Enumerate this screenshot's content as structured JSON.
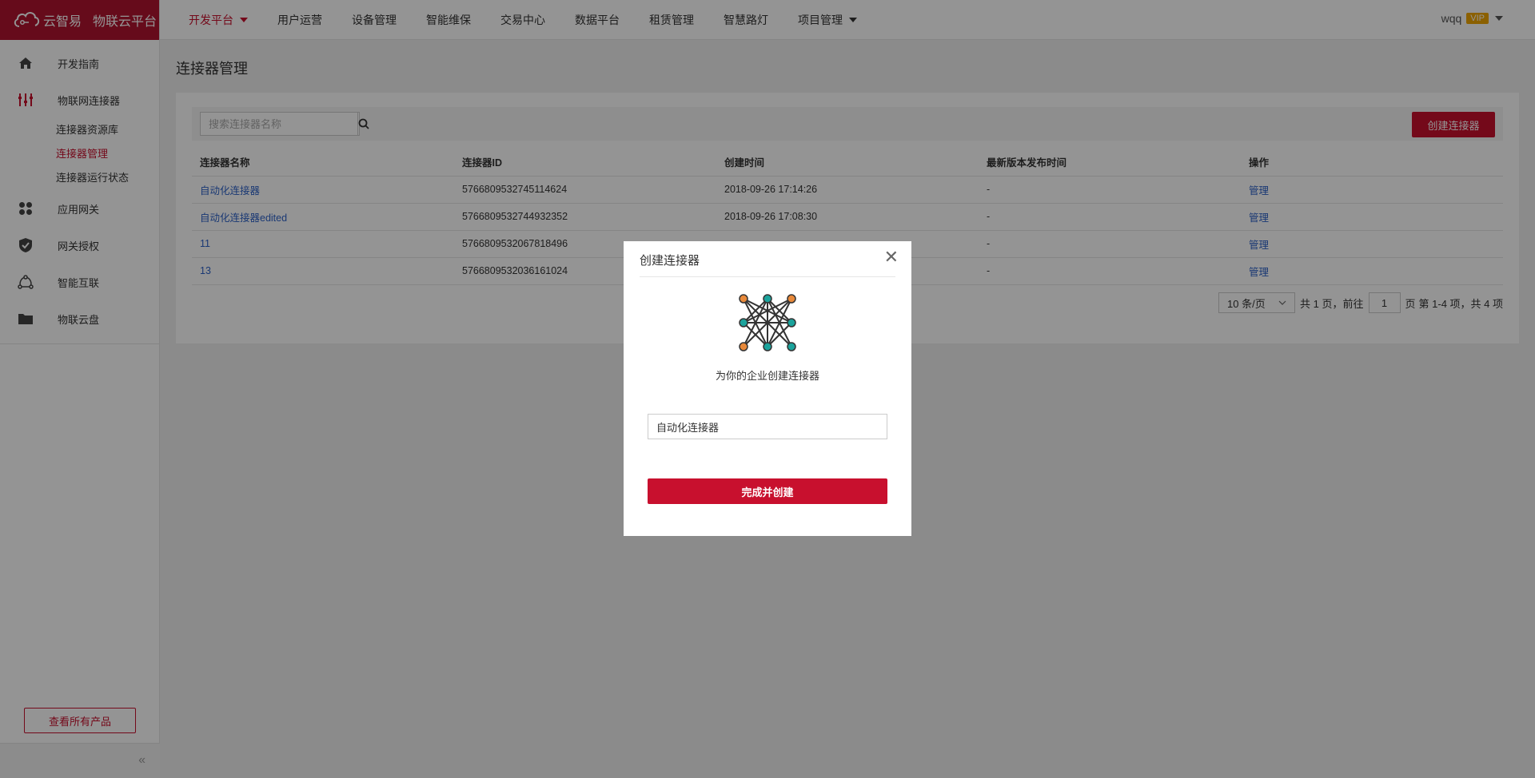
{
  "brand": {
    "name": "云智易",
    "platform": "物联云平台",
    "color": "#b0132f"
  },
  "sidebar": {
    "items": [
      {
        "label": "开发指南",
        "icon": "home-icon"
      },
      {
        "label": "物联网连接器",
        "icon": "connector-icon"
      },
      {
        "label": "应用网关",
        "icon": "apps-icon"
      },
      {
        "label": "网关授权",
        "icon": "shield-check-icon"
      },
      {
        "label": "智能互联",
        "icon": "share-icon"
      },
      {
        "label": "物联云盘",
        "icon": "folder-icon"
      }
    ],
    "sub_items": [
      "连接器资源库",
      "连接器管理",
      "连接器运行状态"
    ],
    "active_sub": "连接器管理",
    "all_products": "查看所有产品",
    "collapse": "«"
  },
  "topnav": {
    "items": [
      "开发平台",
      "用户运营",
      "设备管理",
      "智能维保",
      "交易中心",
      "数据平台",
      "租赁管理",
      "智慧路灯",
      "项目管理"
    ],
    "active": "开发平台",
    "user": "wqq",
    "vip": "VIP"
  },
  "page": {
    "title": "连接器管理",
    "search_placeholder": "搜索连接器名称",
    "create_button": "创建连接器"
  },
  "table": {
    "headers": [
      "连接器名称",
      "连接器ID",
      "创建时间",
      "最新版本发布时间",
      "操作"
    ],
    "rows": [
      {
        "name": "自动化连接器",
        "id": "5766809532745114624",
        "created": "2018-09-26 17:14:26",
        "latest": "-",
        "action": "管理"
      },
      {
        "name": "自动化连接器edited",
        "id": "5766809532744932352",
        "created": "2018-09-26 17:08:30",
        "latest": "-",
        "action": "管理"
      },
      {
        "name": "11",
        "id": "5766809532067818496",
        "created": "",
        "latest": "-",
        "action": "管理"
      },
      {
        "name": "13",
        "id": "5766809532036161024",
        "created": "",
        "latest": "-",
        "action": "管理"
      }
    ]
  },
  "pager": {
    "page_size": "10 条/页",
    "total_pages": "共 1 页，前往",
    "current": "1",
    "suffix": "页",
    "range": "第 1-4 项，共 4 项"
  },
  "modal": {
    "title": "创建连接器",
    "close": "✕",
    "description": "为你的企业创建连接器",
    "input_value": "自动化连接器",
    "submit": "完成并创建"
  },
  "colors": {
    "accent": "#c8102e",
    "link": "#2e62c8",
    "vip": "#f0a500"
  }
}
